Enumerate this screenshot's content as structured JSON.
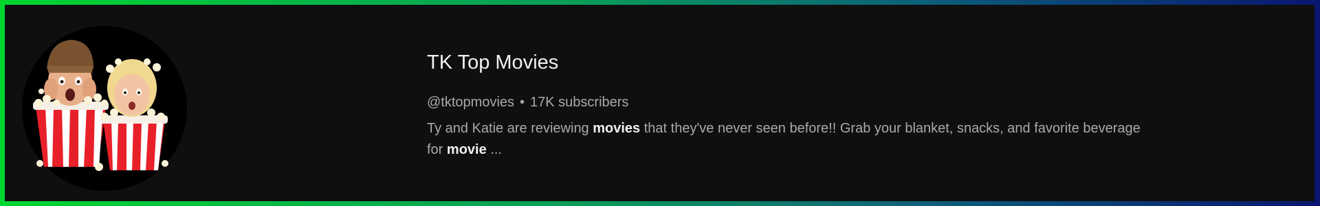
{
  "channel": {
    "name": "TK Top Movies",
    "handle": "@tktopmovies",
    "separator": "•",
    "subscribers": "17K subscribers",
    "description": {
      "part1": "Ty and Katie are reviewing ",
      "bold1": "movies",
      "part2": " that they've never seen before!! Grab your blanket, snacks, and favorite beverage",
      "part3": "for ",
      "bold2": "movie",
      "part4": " ..."
    }
  },
  "colors": {
    "background": "#0f0f0f",
    "border_gradient_start": "#00d630",
    "border_gradient_end": "#0a1670",
    "text_primary": "#f1f1f1",
    "text_secondary": "#aaaaaa"
  },
  "avatar": {
    "icon": "channel-avatar-popcorn"
  }
}
